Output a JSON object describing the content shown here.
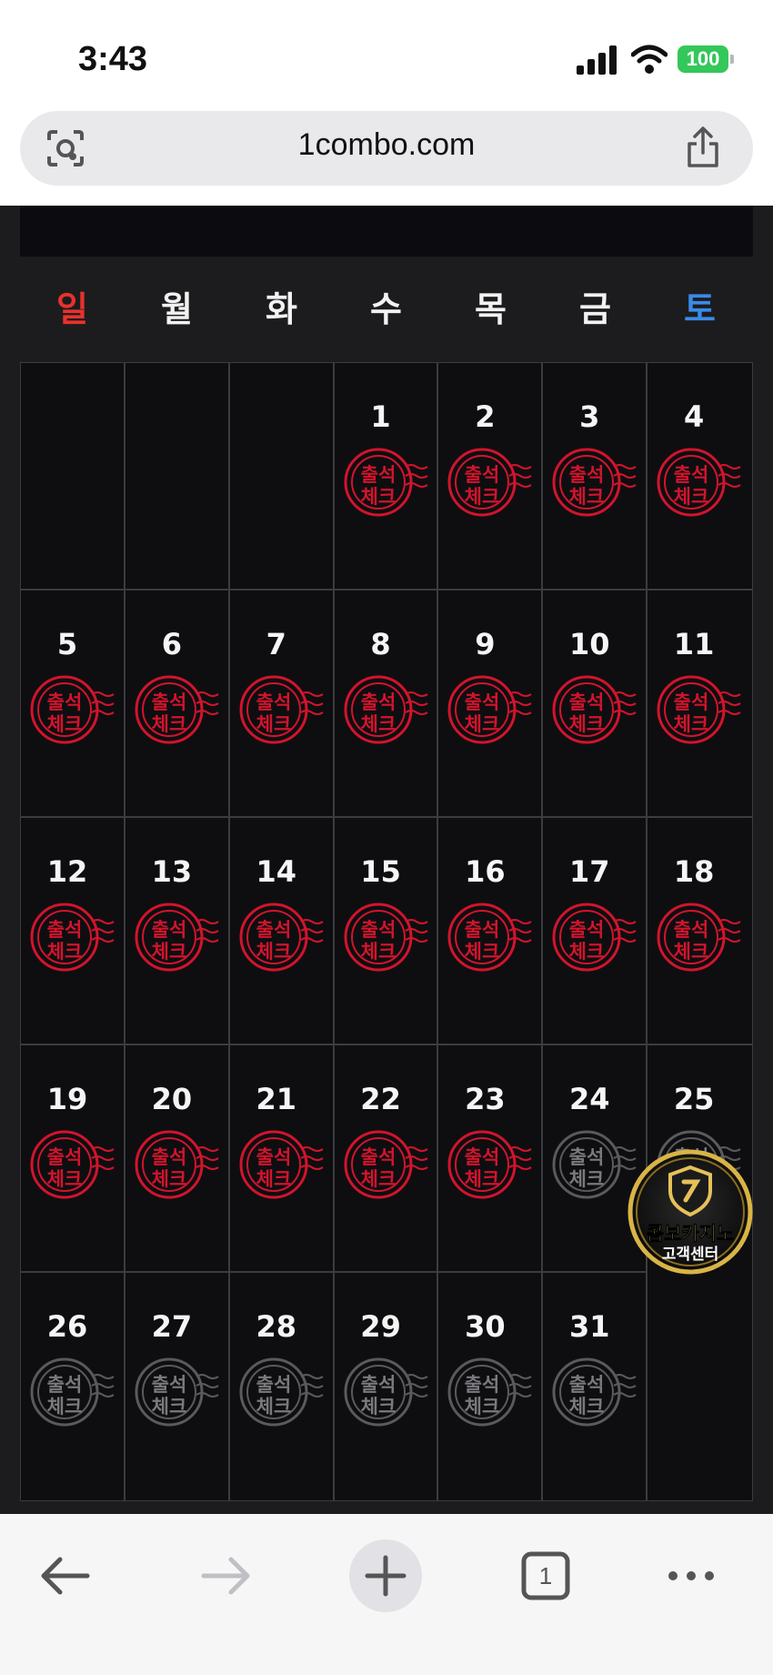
{
  "status_bar": {
    "time": "3:43",
    "battery": "100"
  },
  "browser": {
    "url": "1combo.com",
    "tab_count": "1"
  },
  "calendar": {
    "weekdays": [
      "일",
      "월",
      "화",
      "수",
      "목",
      "금",
      "토"
    ],
    "stamp_text": {
      "line1": "출석",
      "line2": "체크"
    },
    "leading_blank_cells": 3,
    "days": [
      {
        "day": "1",
        "checked": true
      },
      {
        "day": "2",
        "checked": true
      },
      {
        "day": "3",
        "checked": true
      },
      {
        "day": "4",
        "checked": true
      },
      {
        "day": "5",
        "checked": true
      },
      {
        "day": "6",
        "checked": true
      },
      {
        "day": "7",
        "checked": true
      },
      {
        "day": "8",
        "checked": true
      },
      {
        "day": "9",
        "checked": true
      },
      {
        "day": "10",
        "checked": true
      },
      {
        "day": "11",
        "checked": true
      },
      {
        "day": "12",
        "checked": true
      },
      {
        "day": "13",
        "checked": true
      },
      {
        "day": "14",
        "checked": true
      },
      {
        "day": "15",
        "checked": true
      },
      {
        "day": "16",
        "checked": true
      },
      {
        "day": "17",
        "checked": true
      },
      {
        "day": "18",
        "checked": true
      },
      {
        "day": "19",
        "checked": true
      },
      {
        "day": "20",
        "checked": true
      },
      {
        "day": "21",
        "checked": true
      },
      {
        "day": "22",
        "checked": true
      },
      {
        "day": "23",
        "checked": true
      },
      {
        "day": "24",
        "checked": false
      },
      {
        "day": "25",
        "checked": false
      },
      {
        "day": "26",
        "checked": false
      },
      {
        "day": "27",
        "checked": false
      },
      {
        "day": "28",
        "checked": false
      },
      {
        "day": "29",
        "checked": false
      },
      {
        "day": "30",
        "checked": false
      },
      {
        "day": "31",
        "checked": false
      }
    ]
  },
  "support_badge": {
    "line1": "콤보카지노",
    "line2": "고객센터"
  },
  "colors": {
    "stamp_active": "#d2142c",
    "stamp_inactive": "#5a5a5e",
    "sunday": "#e8322c",
    "saturday": "#3a8be8",
    "badge_gold": "#d9b445"
  },
  "icons": [
    "lens-icon",
    "share-icon",
    "back-icon",
    "forward-icon",
    "new-tab-icon",
    "tabs-icon",
    "more-icon",
    "signal-icon",
    "wifi-icon",
    "battery-icon"
  ]
}
